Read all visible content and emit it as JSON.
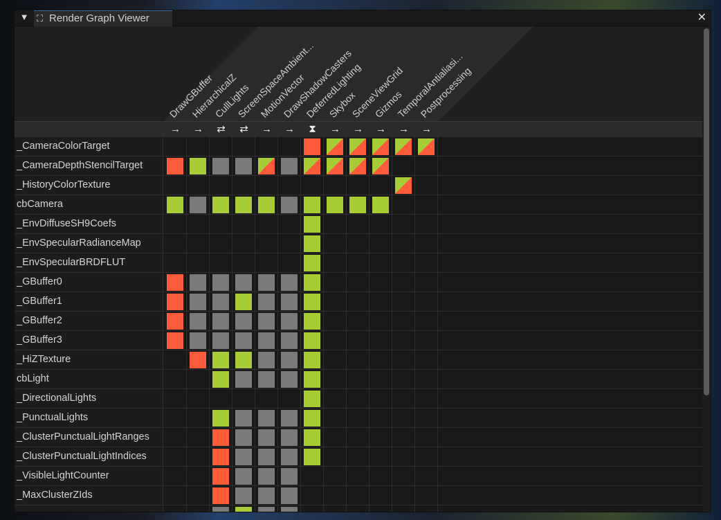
{
  "window": {
    "title": "Render Graph Viewer",
    "menu_icon": "dropdown-menu-icon",
    "tab_icon": "render-graph-icon",
    "close_icon": "close-icon"
  },
  "colors": {
    "write": "#ff5a3c",
    "read": "#a8cc35",
    "unused": "#7a7a7a",
    "readwrite": "diagonal"
  },
  "passes": [
    {
      "name": "DrawGBuffer",
      "icon": "→"
    },
    {
      "name": "HierarchicalZ",
      "icon": "→"
    },
    {
      "name": "CullLights",
      "icon": "⇄"
    },
    {
      "name": "ScreenSpaceAmbient...",
      "icon": "⇄"
    },
    {
      "name": "MotionVector",
      "icon": "→"
    },
    {
      "name": "DrawShadowCasters",
      "icon": "→"
    },
    {
      "name": "DeferredLighting",
      "icon": "⧗"
    },
    {
      "name": "Skybox",
      "icon": "→"
    },
    {
      "name": "SceneViewGrid",
      "icon": "→"
    },
    {
      "name": "Gizmos",
      "icon": "→"
    },
    {
      "name": "TemporalAntialiasi...",
      "icon": "→"
    },
    {
      "name": "Postprocessing",
      "icon": "→"
    }
  ],
  "resources": [
    {
      "name": "_CameraColorTarget",
      "cells": "......rddddd"
    },
    {
      "name": "_CameraDepthStencilTarget",
      "cells": "rgxxdxdddd.."
    },
    {
      "name": "_HistoryColorTexture",
      "cells": "..........d."
    },
    {
      "name": "cbCamera",
      "cells": "gxgggxgggg.."
    },
    {
      "name": "_EnvDiffuseSH9Coefs",
      "cells": "......g....."
    },
    {
      "name": "_EnvSpecularRadianceMap",
      "cells": "......g....."
    },
    {
      "name": "_EnvSpecularBRDFLUT",
      "cells": "......g....."
    },
    {
      "name": "_GBuffer0",
      "cells": "rxxxxxg....."
    },
    {
      "name": "_GBuffer1",
      "cells": "rxxgxxg....."
    },
    {
      "name": "_GBuffer2",
      "cells": "rxxxxxg....."
    },
    {
      "name": "_GBuffer3",
      "cells": "rxxxxxg....."
    },
    {
      "name": "_HiZTexture",
      "cells": ".rggxxg....."
    },
    {
      "name": "cbLight",
      "cells": "..gxxxg....."
    },
    {
      "name": "_DirectionalLights",
      "cells": "......g....."
    },
    {
      "name": "_PunctualLights",
      "cells": "..gxxxg....."
    },
    {
      "name": "_ClusterPunctualLightRanges",
      "cells": "..rxxxg....."
    },
    {
      "name": "_ClusterPunctualLightIndices",
      "cells": "..rxxxg....."
    },
    {
      "name": "_VisibleLightCounter",
      "cells": "..rxxx......"
    },
    {
      "name": "_MaxClusterZIds",
      "cells": "..rxxx......"
    },
    {
      "name": "",
      "cells": "..xgxx......"
    }
  ]
}
